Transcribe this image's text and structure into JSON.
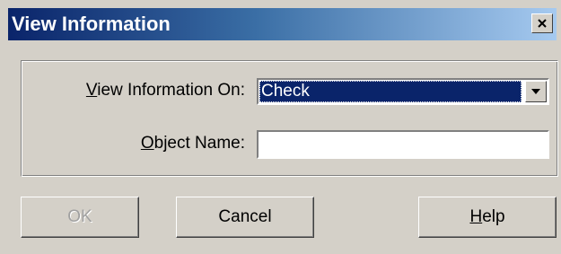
{
  "window": {
    "title": "View Information",
    "close_icon": "close-icon"
  },
  "form": {
    "view_on_label_mnemonic": "V",
    "view_on_label_rest": "iew Information On:",
    "view_on_value": "Check",
    "object_name_label_mnemonic": "O",
    "object_name_label_rest": "bject Name:",
    "object_name_value": ""
  },
  "buttons": {
    "ok": "OK",
    "ok_enabled": false,
    "cancel": "Cancel",
    "help_mnemonic": "H",
    "help_rest": "elp"
  },
  "colors": {
    "face": "#d4d0c8",
    "title_start": "#0a246a",
    "title_end": "#a6caf0",
    "selection": "#0a246a"
  }
}
